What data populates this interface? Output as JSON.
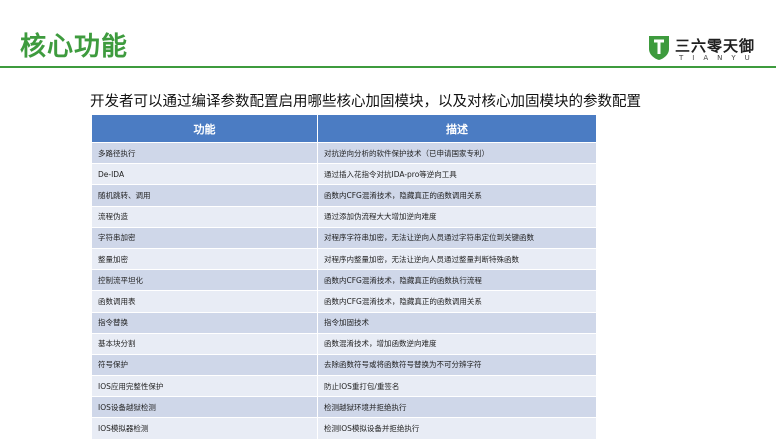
{
  "header": {
    "title": "核心功能",
    "accent_color": "#3e9b3e",
    "logo": {
      "name": "三六零天御",
      "sub": "TIANYU",
      "icon": "tianyu-shield-logo"
    }
  },
  "subtitle": "开发者可以通过编译参数配置启用哪些核心加固模块，以及对核心加固模块的参数配置",
  "table": {
    "header_color": "#4b7cc3",
    "columns": [
      "功能",
      "描述"
    ],
    "rows": [
      [
        "多路径执行",
        "对抗逆向分析的软件保护技术（已申请国家专利）"
      ],
      [
        "De-IDA",
        "通过插入花指令对抗IDA-pro等逆向工具"
      ],
      [
        "随机跳转、调用",
        "函数内CFG混淆技术，隐藏真正的函数调用关系"
      ],
      [
        "流程伪造",
        "通过添加伪流程大大增加逆向难度"
      ],
      [
        "字符串加密",
        "对程序字符串加密，无法让逆向人员通过字符串定位到关键函数"
      ],
      [
        "整量加密",
        "对程序内整量加密，无法让逆向人员通过整量判断特殊函数"
      ],
      [
        "控制流平坦化",
        "函数内CFG混淆技术，隐藏真正的函数执行流程"
      ],
      [
        "函数调用表",
        "函数内CFG混淆技术，隐藏真正的函数调用关系"
      ],
      [
        "指令替换",
        "指令加固技术"
      ],
      [
        "基本块分割",
        "函数混淆技术，增加函数逆向难度"
      ],
      [
        "符号保护",
        "去除函数符号或将函数符号替换为不可分辨字符"
      ],
      [
        "IOS应用完整性保护",
        "防止IOS重打包/重签名"
      ],
      [
        "IOS设备越狱检测",
        "检测越狱环境并拒绝执行"
      ],
      [
        "IOS模拟器检测",
        "检测IOS模拟设备并拒绝执行"
      ]
    ]
  }
}
